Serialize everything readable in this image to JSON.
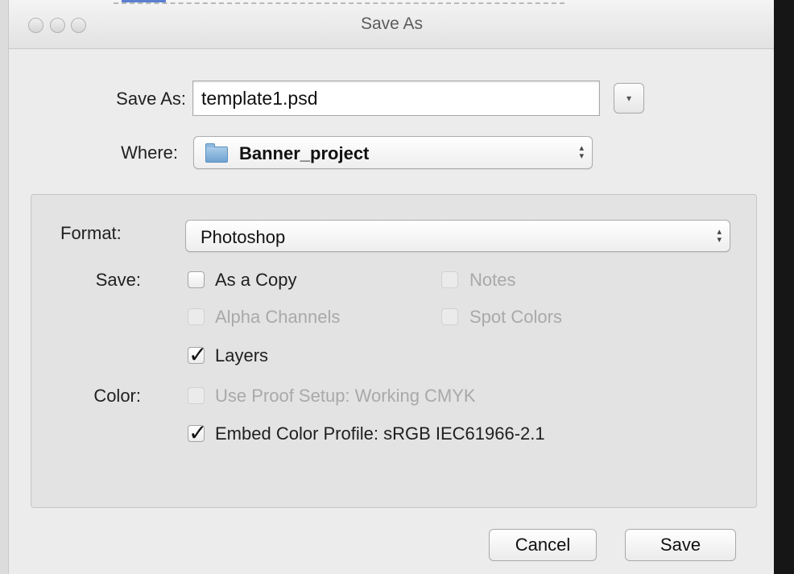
{
  "window": {
    "title": "Save As"
  },
  "save_as": {
    "label": "Save As:",
    "value": "template1.psd",
    "expand_glyph": "▾"
  },
  "where": {
    "label": "Where:",
    "value": "Banner_project",
    "icon": "folder-icon"
  },
  "format": {
    "label": "Format:",
    "value": "Photoshop"
  },
  "save_section": {
    "label": "Save:",
    "options": {
      "as_a_copy": {
        "label": "As a Copy",
        "checked": false,
        "enabled": true
      },
      "notes": {
        "label": "Notes",
        "checked": false,
        "enabled": false
      },
      "alpha_channels": {
        "label": "Alpha Channels",
        "checked": false,
        "enabled": false
      },
      "spot_colors": {
        "label": "Spot Colors",
        "checked": false,
        "enabled": false
      },
      "layers": {
        "label": "Layers",
        "checked": true,
        "enabled": true
      }
    }
  },
  "color_section": {
    "label": "Color:",
    "options": {
      "use_proof_setup": {
        "label": "Use Proof Setup:  Working CMYK",
        "checked": false,
        "enabled": false
      },
      "embed_color_profile": {
        "label": "Embed Color Profile:  sRGB IEC61966-2.1",
        "checked": true,
        "enabled": true
      }
    }
  },
  "buttons": {
    "cancel": "Cancel",
    "save": "Save"
  },
  "glyphs": {
    "check": "✓",
    "popup_arrows": "▴▾"
  }
}
